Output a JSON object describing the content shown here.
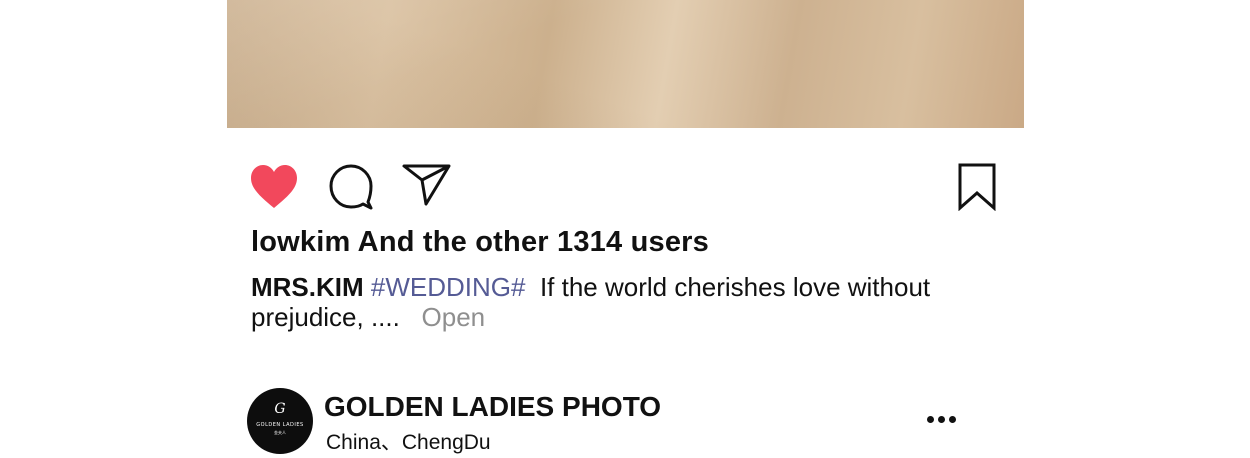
{
  "post": {
    "likes_text": "lowkim And the other 1314 users",
    "caption": {
      "author": "MRS.KIM",
      "hashtag": "#WEDDING#",
      "text": "If the world cherishes love without prejudice, ....",
      "open_label": "Open"
    },
    "icons": {
      "like": "heart-icon",
      "comment": "comment-icon",
      "share": "send-icon",
      "save": "bookmark-icon",
      "more": "more-dots-icon"
    },
    "colors": {
      "like_active": "#f2485c",
      "hashtag": "#555b95",
      "muted": "#8f8f8f"
    }
  },
  "profile": {
    "name": "GOLDEN LADIES PHOTO",
    "location": "China、ChengDu",
    "avatar_logo": {
      "mark": "G",
      "text": "GOLDEN LADIES",
      "sub": "金夫人"
    }
  }
}
